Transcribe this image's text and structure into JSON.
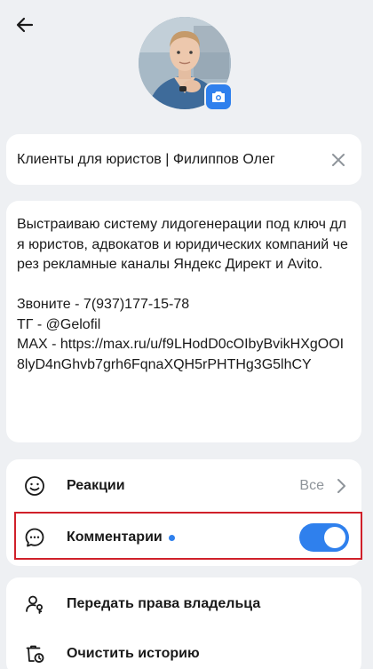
{
  "header": {
    "back_icon": "arrow-left-icon"
  },
  "avatar": {
    "camera_icon": "camera-icon",
    "accent": "#2f80ed"
  },
  "name_field": {
    "value": "Клиенты для юристов | Филиппов Олег",
    "clear_icon": "close-icon"
  },
  "bio": {
    "text": "Выстраиваю систему лидогенерации под ключ для юристов, адвокатов и юридических компаний через рекламные каналы Яндекс Директ и Avito.\n\nЗвоните - 7(937)177-15-78\nТГ - @Gelofil\nMAX - https://max.ru/u/f9LHodD0cOIbyBvikHXgOOI8lyD4nGhvb7grh6FqnaXQH5rPHTHg3G5lhCY"
  },
  "settings": {
    "reactions": {
      "label": "Реакции",
      "value": "Все",
      "icon": "smile-icon"
    },
    "comments": {
      "label": "Комментарии",
      "icon": "chat-bubble-icon",
      "enabled": true
    }
  },
  "actions": {
    "transfer": {
      "label": "Передать права владельца",
      "icon": "user-key-icon"
    },
    "clear_history": {
      "label": "Очистить историю",
      "icon": "trash-clock-icon"
    }
  },
  "colors": {
    "accent": "#2f80ed",
    "highlight": "#d0202a",
    "background": "#eef0f3"
  }
}
